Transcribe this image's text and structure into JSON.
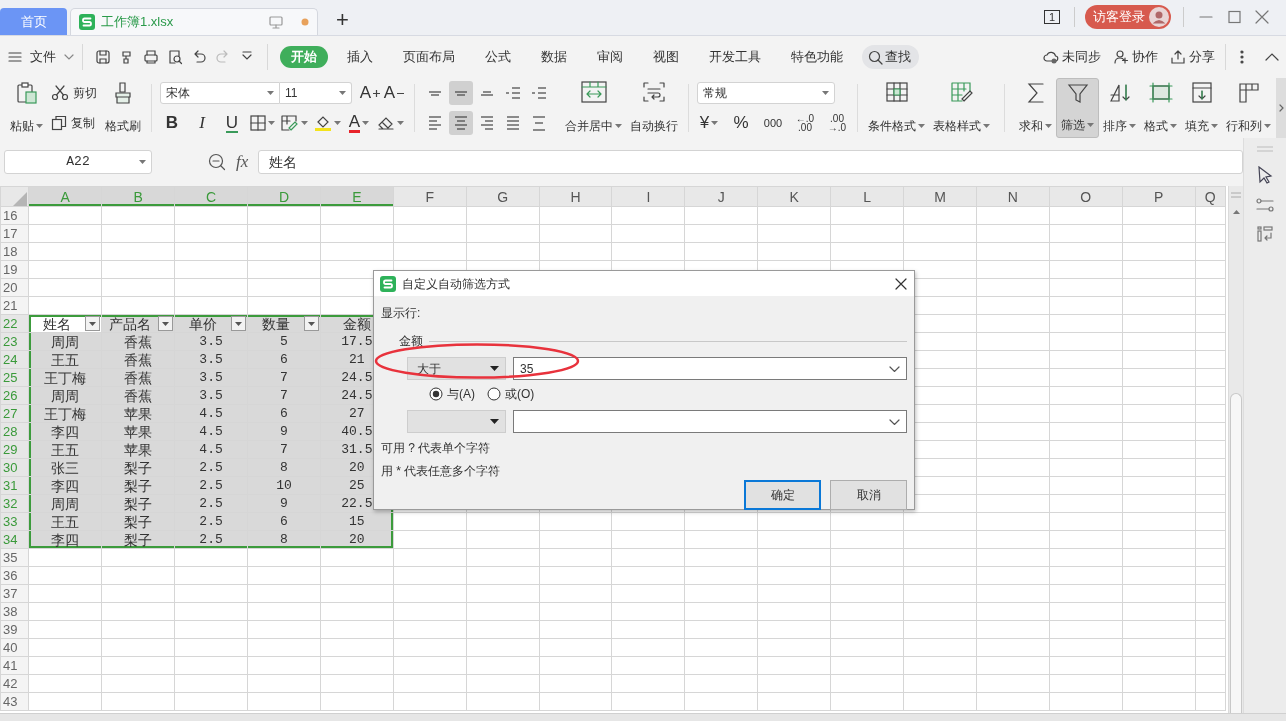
{
  "tabs": [
    {
      "label": "首页",
      "kind": "home",
      "selected": false,
      "modified": false
    },
    {
      "label": "工作簿1.xlsx",
      "kind": "document",
      "selected": true,
      "modified": true
    }
  ],
  "new_tab": "+",
  "account": {
    "window_count": "1",
    "login": "访客登录"
  },
  "menu": {
    "file": "文件",
    "quick_access": [
      {
        "disabled": false
      },
      {
        "disabled": false
      },
      {
        "disabled": false
      },
      {
        "disabled": false
      },
      {
        "disabled": false
      },
      {
        "disabled": true
      },
      {
        "disabled": false
      }
    ],
    "tabs": [
      {
        "label": "开始",
        "selected": true
      },
      {
        "label": "插入",
        "selected": false
      },
      {
        "label": "页面布局",
        "selected": false
      },
      {
        "label": "公式",
        "selected": false
      },
      {
        "label": "数据",
        "selected": false
      },
      {
        "label": "审阅",
        "selected": false
      },
      {
        "label": "视图",
        "selected": false
      },
      {
        "label": "开发工具",
        "selected": false
      },
      {
        "label": "特色功能",
        "selected": false
      }
    ],
    "search": "查找",
    "right": [
      "未同步",
      "协作",
      "分享"
    ]
  },
  "ribbon": {
    "clipboard": {
      "paste": "粘贴",
      "cut": "剪切",
      "copy": "复制",
      "painter": "格式刷"
    },
    "font": {
      "name": "宋体",
      "size": "11",
      "grow": "A",
      "shrink": "A",
      "bold": "B",
      "italic": "I",
      "underline": "U",
      "text_color": "A"
    },
    "align_buttons": [
      {
        "selected": false
      },
      {
        "selected": true
      },
      {
        "selected": false
      },
      {
        "selected": false
      },
      {
        "selected": false
      },
      {
        "selected": false
      },
      {
        "selected": true
      },
      {
        "selected": false
      },
      {
        "selected": false
      },
      {
        "selected": false
      }
    ],
    "merge": "合并居中",
    "wrap": "自动换行",
    "number": {
      "format": "常规",
      "currency": "¥",
      "percent": "%",
      "thousands": "000",
      "decimals": [
        {
          "top": "←.0",
          "bottom": ".00"
        },
        {
          "top": ".00",
          "bottom": "→.0"
        }
      ]
    },
    "tools": [
      {
        "label": "条件格式",
        "selected": false
      },
      {
        "label": "表格样式",
        "selected": false
      },
      {
        "label": "求和",
        "selected": false
      },
      {
        "label": "筛选",
        "selected": true
      },
      {
        "label": "排序",
        "selected": false
      },
      {
        "label": "格式",
        "selected": false
      },
      {
        "label": "填充",
        "selected": false
      },
      {
        "label": "行和列",
        "selected": false
      }
    ]
  },
  "formula_bar": {
    "name_box": "A22",
    "fx": "fx",
    "formula": "姓名"
  },
  "sheet": {
    "columns": [
      {
        "label": "A",
        "selected": true
      },
      {
        "label": "B",
        "selected": true
      },
      {
        "label": "C",
        "selected": true
      },
      {
        "label": "D",
        "selected": true
      },
      {
        "label": "E",
        "selected": true
      },
      {
        "label": "F",
        "selected": false
      },
      {
        "label": "G",
        "selected": false
      },
      {
        "label": "H",
        "selected": false
      },
      {
        "label": "I",
        "selected": false
      },
      {
        "label": "J",
        "selected": false
      },
      {
        "label": "K",
        "selected": false
      },
      {
        "label": "L",
        "selected": false
      },
      {
        "label": "M",
        "selected": false
      },
      {
        "label": "N",
        "selected": false
      },
      {
        "label": "O",
        "selected": false
      },
      {
        "label": "P",
        "selected": false
      },
      {
        "label": "Q",
        "selected": false
      }
    ],
    "rows": [
      {
        "number": "16",
        "selected": false
      },
      {
        "number": "17",
        "selected": false
      },
      {
        "number": "18",
        "selected": false
      },
      {
        "number": "19",
        "selected": false
      },
      {
        "number": "20",
        "selected": false
      },
      {
        "number": "21",
        "selected": false
      },
      {
        "number": "22",
        "selected": true,
        "cells": [
          {
            "text": "姓名",
            "filter": true,
            "active": true
          },
          {
            "text": "产品名",
            "filter": true,
            "active": false
          },
          {
            "text": "单价",
            "filter": true,
            "active": false
          },
          {
            "text": "数量",
            "filter": true,
            "active": false
          },
          {
            "text": "金额",
            "filter": false,
            "active": false
          }
        ]
      },
      {
        "number": "23",
        "selected": true,
        "cells": [
          "周周",
          "香蕉",
          "3.5",
          "5",
          "17.5"
        ]
      },
      {
        "number": "24",
        "selected": true,
        "cells": [
          "王五",
          "香蕉",
          "3.5",
          "6",
          "21"
        ]
      },
      {
        "number": "25",
        "selected": true,
        "cells": [
          "王丁梅",
          "香蕉",
          "3.5",
          "7",
          "24.5"
        ]
      },
      {
        "number": "26",
        "selected": true,
        "cells": [
          "周周",
          "香蕉",
          "3.5",
          "7",
          "24.5"
        ]
      },
      {
        "number": "27",
        "selected": true,
        "cells": [
          "王丁梅",
          "苹果",
          "4.5",
          "6",
          "27"
        ]
      },
      {
        "number": "28",
        "selected": true,
        "cells": [
          "李四",
          "苹果",
          "4.5",
          "9",
          "40.5"
        ]
      },
      {
        "number": "29",
        "selected": true,
        "cells": [
          "王五",
          "苹果",
          "4.5",
          "7",
          "31.5"
        ]
      },
      {
        "number": "30",
        "selected": true,
        "cells": [
          "张三",
          "梨子",
          "2.5",
          "8",
          "20"
        ]
      },
      {
        "number": "31",
        "selected": true,
        "cells": [
          "李四",
          "梨子",
          "2.5",
          "10",
          "25"
        ]
      },
      {
        "number": "32",
        "selected": true,
        "cells": [
          "周周",
          "梨子",
          "2.5",
          "9",
          "22.5"
        ]
      },
      {
        "number": "33",
        "selected": true,
        "cells": [
          "王五",
          "梨子",
          "2.5",
          "6",
          "15"
        ]
      },
      {
        "number": "34",
        "selected": true,
        "cells": [
          "李四",
          "梨子",
          "2.5",
          "8",
          "20"
        ]
      },
      {
        "number": "35",
        "selected": false
      },
      {
        "number": "36",
        "selected": false
      },
      {
        "number": "37",
        "selected": false
      },
      {
        "number": "38",
        "selected": false
      },
      {
        "number": "39",
        "selected": false
      },
      {
        "number": "40",
        "selected": false
      },
      {
        "number": "41",
        "selected": false
      },
      {
        "number": "42",
        "selected": false
      },
      {
        "number": "43",
        "selected": false
      }
    ]
  },
  "dialog": {
    "title": "自定义自动筛选方式",
    "show_rows": "显示行:",
    "column": "金额",
    "conditions": [
      {
        "kind": "filled",
        "operator": "大于",
        "value": "35"
      },
      {
        "kind": "blank"
      }
    ],
    "logic": [
      {
        "label": "与(A)",
        "selected": true
      },
      {
        "label": "或(O)",
        "selected": false
      }
    ],
    "hints": [
      "可用 ? 代表单个字符",
      "用 * 代表任意多个字符"
    ],
    "buttons": [
      {
        "label": "确定",
        "focused": true
      },
      {
        "label": "取消",
        "focused": false
      }
    ]
  },
  "annotations": [
    {
      "kind": "ellipse"
    }
  ]
}
